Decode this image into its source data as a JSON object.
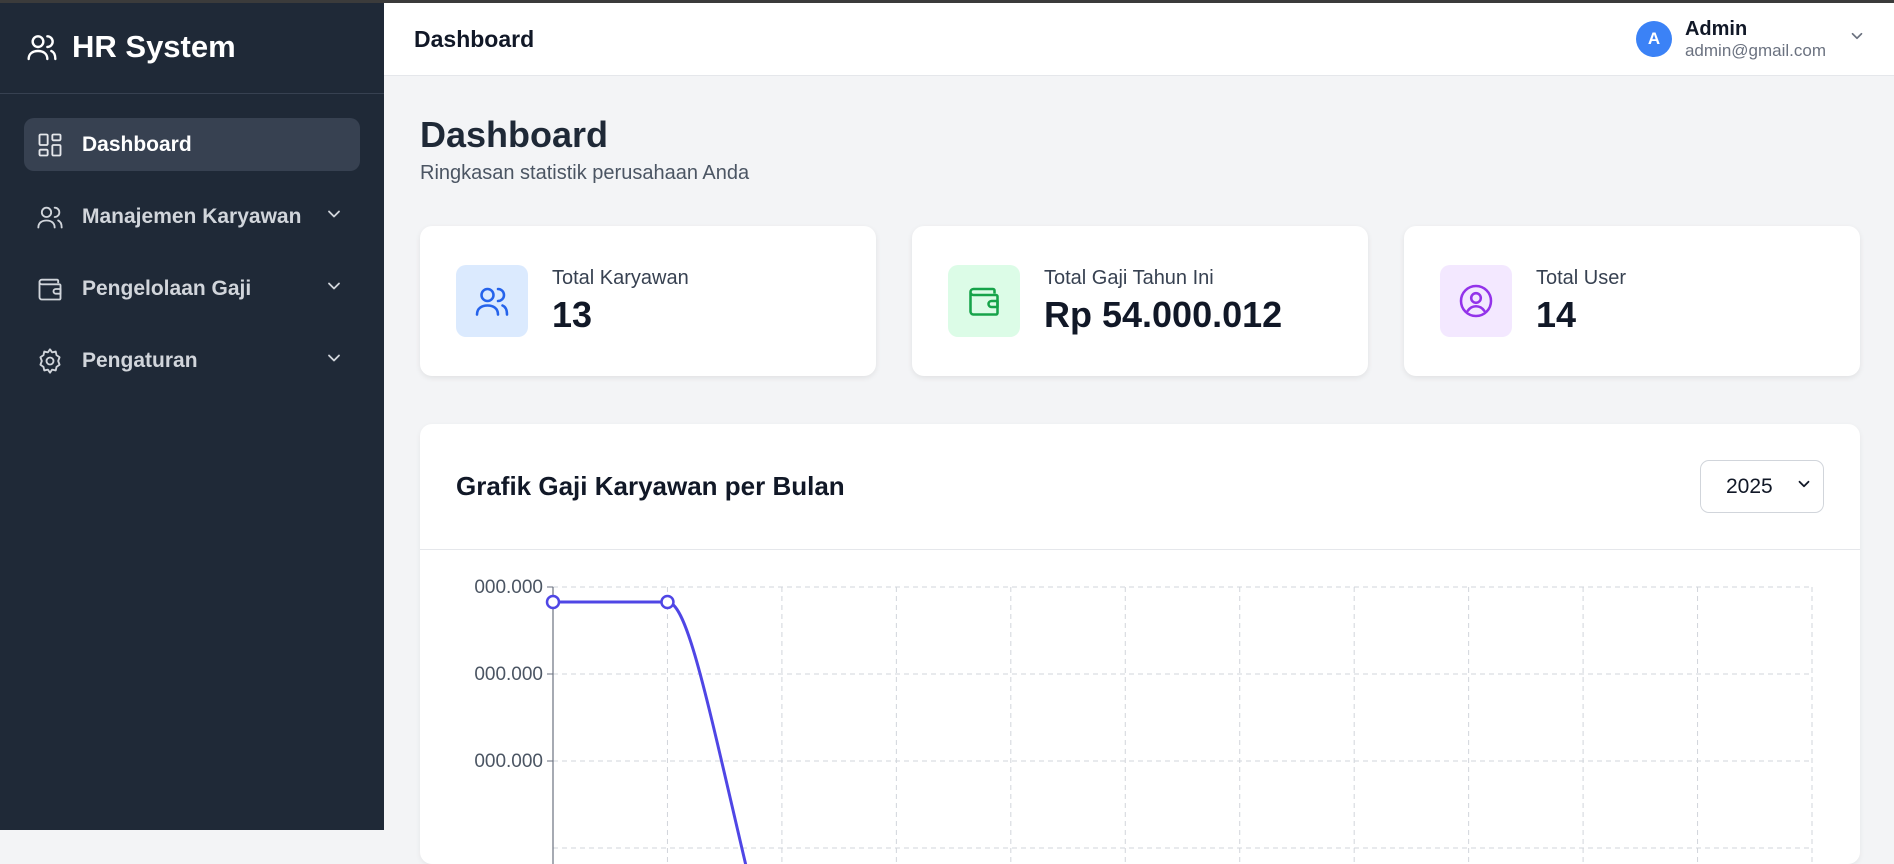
{
  "sidebar": {
    "brand": "HR System",
    "items": [
      {
        "label": "Dashboard",
        "icon": "dashboard-grid-icon",
        "active": true
      },
      {
        "label": "Manajemen Karyawan",
        "icon": "users-icon",
        "expandable": true
      },
      {
        "label": "Pengelolaan Gaji",
        "icon": "wallet-icon",
        "expandable": true
      },
      {
        "label": "Pengaturan",
        "icon": "gear-icon",
        "expandable": true
      }
    ]
  },
  "header": {
    "title": "Dashboard",
    "user": {
      "initial": "A",
      "name": "Admin",
      "email": "admin@gmail.com"
    }
  },
  "page": {
    "title": "Dashboard",
    "subtitle": "Ringkasan statistik perusahaan Anda"
  },
  "stats": [
    {
      "label": "Total Karyawan",
      "value": "13",
      "icon": "users-icon",
      "color": "#2563eb",
      "bg": "#dbeafe"
    },
    {
      "label": "Total Gaji Tahun Ini",
      "value": "Rp 54.000.012",
      "icon": "wallet-icon",
      "color": "#16a34a",
      "bg": "#dcfce7"
    },
    {
      "label": "Total User",
      "value": "14",
      "icon": "user-circle-icon",
      "color": "#9333ea",
      "bg": "#f3e8ff"
    }
  ],
  "chart": {
    "title": "Grafik Gaji Karyawan per Bulan",
    "year": "2025"
  },
  "colors": {
    "line": "#4f46e5",
    "sidebar": "#1f2937",
    "grid": "#d1d5db"
  },
  "chart_data": {
    "type": "line",
    "grid": true,
    "y_tick_labels": [
      "000.000",
      "000.000",
      "000.000"
    ],
    "points_visible": [
      {
        "x": 1,
        "y": 1.0
      },
      {
        "x": 2,
        "y": 1.0
      }
    ],
    "note_visible_trend": "decreasing after point 2"
  }
}
